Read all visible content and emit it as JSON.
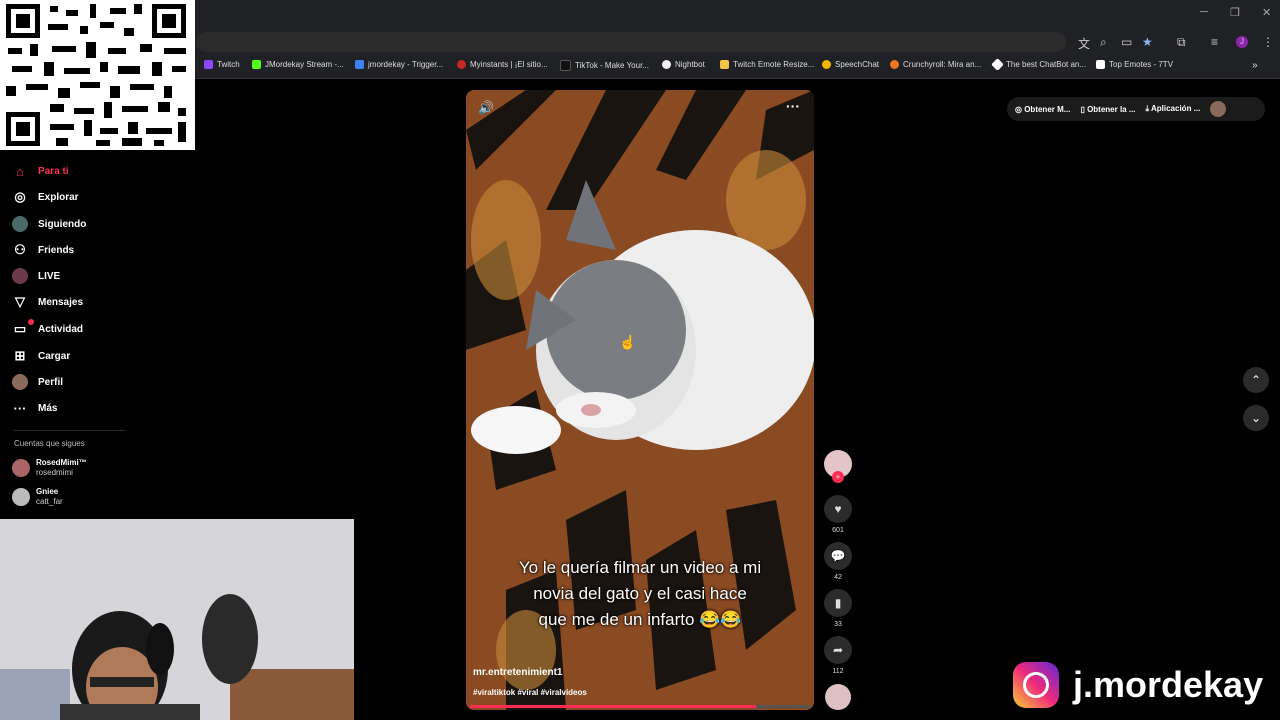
{
  "bookmarks": [
    "Twitch",
    "JMordekay Stream -...",
    "jmordekay - Trigger...",
    "Myinstants | ¡El sitio...",
    "TikTok - Make Your...",
    "Nightbot",
    "Twitch Emote Resize...",
    "SpeechChat",
    "Crunchyroll: Mira an...",
    "The best ChatBot an...",
    "Top Emotes - 7TV"
  ],
  "sidebar": {
    "items": [
      {
        "label": "Para ti",
        "icon": "home-icon"
      },
      {
        "label": "Explorar",
        "icon": "compass-icon"
      },
      {
        "label": "Siguiendo",
        "icon": "following-icon"
      },
      {
        "label": "Friends",
        "icon": "friends-icon"
      },
      {
        "label": "LIVE",
        "icon": "live-icon"
      },
      {
        "label": "Mensajes",
        "icon": "send-icon"
      },
      {
        "label": "Actividad",
        "icon": "activity-icon"
      },
      {
        "label": "Cargar",
        "icon": "upload-icon"
      },
      {
        "label": "Perfil",
        "icon": "profile-icon"
      },
      {
        "label": "Más",
        "icon": "more-icon"
      }
    ],
    "following_title": "Cuentas que sigues",
    "following": [
      {
        "name": "RosedMimi™",
        "handle": "rosedmimi"
      },
      {
        "name": "Gniee",
        "handle": "catt_far"
      }
    ]
  },
  "topbar": {
    "get_coins": "Obtener M...",
    "get_app": "Obtener la ...",
    "application": "Aplicación ..."
  },
  "video": {
    "caption_lines": [
      "Yo le quería filmar un video a mi",
      "novia del gato y el casi hace",
      "que me de un infarto 😂😂"
    ],
    "author": "mr.entretenimient1",
    "hashtags": "#viraltiktok #viral #viralvideos",
    "progress": 0.84
  },
  "actions": {
    "likes": "601",
    "comments": "42",
    "saves": "33",
    "shares": "112"
  },
  "brand": {
    "handle": "j.mordekay"
  },
  "colors": {
    "accent": "#fe2c55",
    "sidebar_active": "#fe2c55"
  }
}
